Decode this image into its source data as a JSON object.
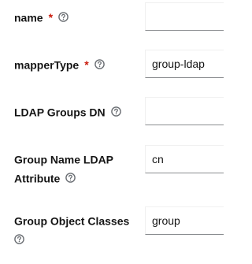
{
  "fields": [
    {
      "label": "name",
      "required": true,
      "value": ""
    },
    {
      "label": "mapperType",
      "required": true,
      "value": "group-ldap"
    },
    {
      "label": "LDAP Groups DN",
      "required": false,
      "value": ""
    },
    {
      "label_line1": "Group Name LDAP",
      "label_line2": "Attribute",
      "required": false,
      "value": "cn"
    },
    {
      "label": "Group Object Classes",
      "required": false,
      "value": "group"
    }
  ],
  "required_marker": "*",
  "icons": {
    "help": "help-circle-icon"
  },
  "colors": {
    "required": "#c9190b",
    "help_icon": "#6a6e73",
    "input_border_bottom": "#8a8d90"
  }
}
